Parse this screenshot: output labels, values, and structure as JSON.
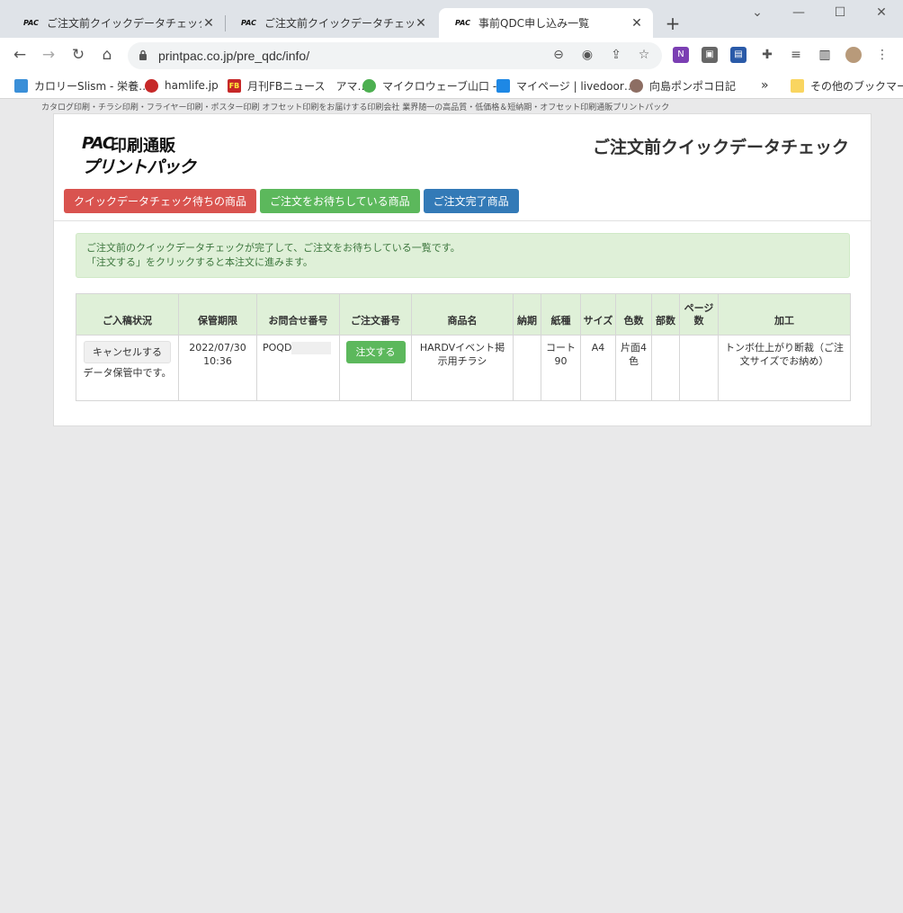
{
  "browser": {
    "tabs": [
      {
        "title": "ご注文前クイックデータチェック　サービス",
        "favicon": "PAC"
      },
      {
        "title": "ご注文前クイックデータチェック　サービス",
        "favicon": "PAC"
      },
      {
        "title": "事前QDC申し込み一覧",
        "favicon": "PAC"
      }
    ],
    "url": "printpac.co.jp/pre_qdc/info/",
    "bookmarks": [
      {
        "label": "カロリーSlism - 栄養…"
      },
      {
        "label": "hamlife.jp"
      },
      {
        "label": "月刊FBニュース　アマ…",
        "icon_text": "FB"
      },
      {
        "label": "マイクロウェーブ山口 -…"
      },
      {
        "label": "マイページ | livedoor…"
      },
      {
        "label": "向島ポンポコ日記"
      },
      {
        "label": "その他のブックマーク"
      }
    ],
    "more_bookmarks": "»"
  },
  "page": {
    "tagline": "カタログ印刷・チラシ印刷・フライヤー印刷・ポスター印刷 オフセット印刷をお届けする印刷会社 業界随一の高品質・低価格＆短納期・オフセット印刷通販プリントパック",
    "logo": {
      "mark": "PAC",
      "line1": "印刷通販",
      "line2": "プリントパック"
    },
    "title": "ご注文前クイックデータチェック",
    "nav_tabs": [
      {
        "label": "クイックデータチェック待ちの商品",
        "color": "#d9534f"
      },
      {
        "label": "ご注文をお待ちしている商品",
        "color": "#5cb85c"
      },
      {
        "label": "ご注文完了商品",
        "color": "#337ab7"
      }
    ],
    "alert": {
      "line1": "ご注文前のクイックデータチェックが完了して、ご注文をお待ちしている一覧です。",
      "line2": "「注文する」をクリックすると本注文に進みます。"
    },
    "table": {
      "headers": [
        "ご入稿状況",
        "保管期限",
        "お問合せ番号",
        "ご注文番号",
        "商品名",
        "納期",
        "紙種",
        "サイズ",
        "色数",
        "部数",
        "ページ数",
        "加工"
      ],
      "row": {
        "cancel_label": "キャンセルする",
        "status": "データ保管中です。",
        "expiry_date": "2022/07/30",
        "expiry_time": "10:36",
        "inquiry": "POQD",
        "order_label": "注文する",
        "product": "HARDVイベント掲示用チラシ",
        "delivery": "",
        "paper": "コート90",
        "size": "A4",
        "colors": "片面4色",
        "copies": "",
        "pages": "",
        "processing": "トンボ仕上がり断裁（ご注文サイズでお納め）"
      }
    }
  }
}
